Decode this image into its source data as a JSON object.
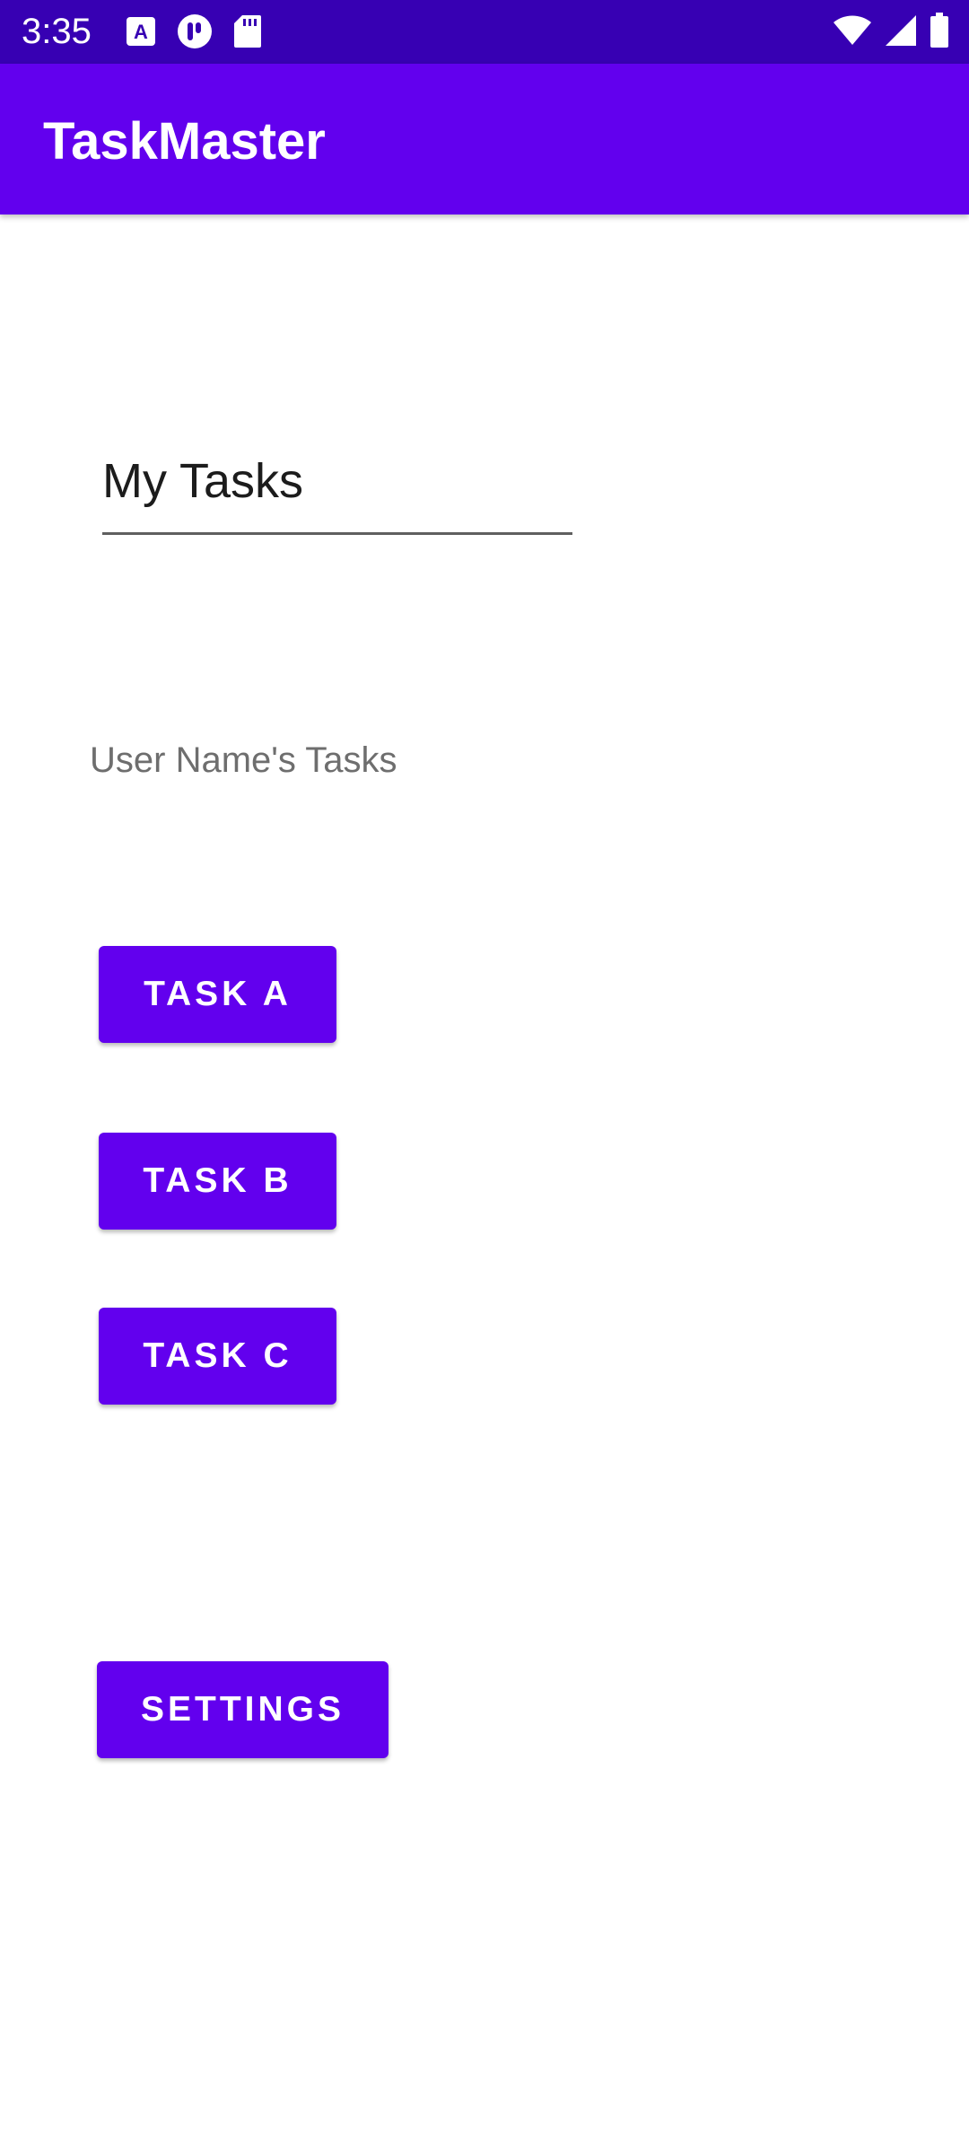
{
  "status_bar": {
    "time": "3:35",
    "color": "#3700b3",
    "left_icons": [
      "accessibility-a-icon",
      "podcast-icon",
      "sd-card-icon"
    ],
    "right_icons": [
      "wifi-icon",
      "cellular-signal-icon",
      "battery-icon"
    ]
  },
  "app_bar": {
    "title": "TaskMaster",
    "color": "#6200ee"
  },
  "main": {
    "title_field_value": "My Tasks",
    "subtitle": "User Name's Tasks",
    "task_buttons": [
      {
        "label": "Task A"
      },
      {
        "label": "Task B"
      },
      {
        "label": "Task C"
      }
    ],
    "settings_button": {
      "label": "Settings"
    }
  }
}
